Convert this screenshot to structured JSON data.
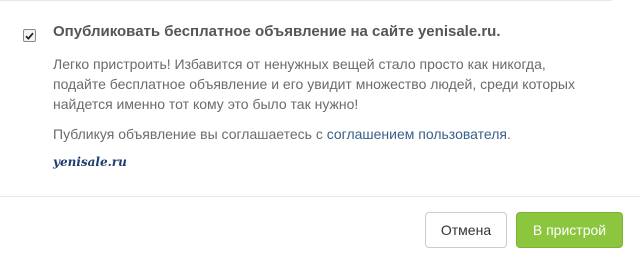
{
  "dialog": {
    "checkbox_checked": true,
    "heading": "Опубликовать бесплатное объявление на сайте yenisale.ru.",
    "description": "Легко пристроить! Избавится от ненужных вещей стало просто как никогда, подайте бесплатное объявление и его увидит множество людей, среди которых найдется именно тот кому это было так нужно!",
    "agreement_prefix": "Публикуя объявление вы соглашаетесь с ",
    "agreement_link": "соглашением пользователя",
    "agreement_suffix": ".",
    "logo_text": "yenisale.ru"
  },
  "footer": {
    "cancel_label": "Отмена",
    "submit_label": "В пристрой"
  },
  "colors": {
    "submit_bg": "#8cc63f",
    "link": "#3a5f8a",
    "logo": "#1e3c6e"
  }
}
